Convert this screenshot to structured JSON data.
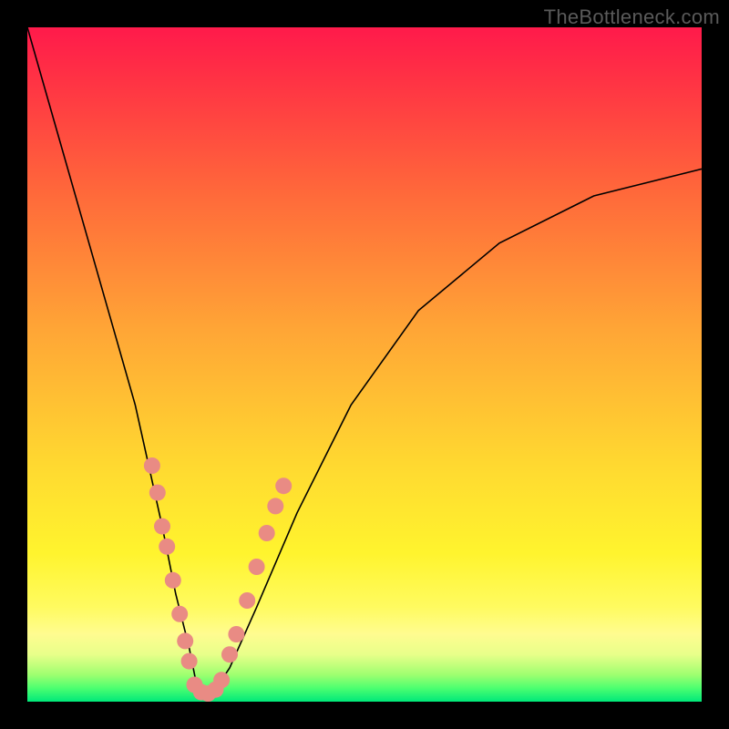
{
  "watermark": "TheBottleneck.com",
  "colors": {
    "background": "#000000",
    "curve": "#000000",
    "dot": "#e98b84",
    "gradient_top": "#ff1a4b",
    "gradient_bottom": "#00e87a"
  },
  "chart_data": {
    "type": "line",
    "title": "",
    "xlabel": "",
    "ylabel": "",
    "xlim": [
      0,
      100
    ],
    "ylim": [
      0,
      100
    ],
    "note": "Conceptual bottleneck V-curve; axes unlabeled; values estimated from pixel positions on a 0–100 normalized scale (y inverted to image space).",
    "series": [
      {
        "name": "curve",
        "x": [
          0,
          4,
          8,
          12,
          16,
          20,
          22,
          24,
          25,
          26,
          27,
          28,
          30,
          34,
          40,
          48,
          58,
          70,
          84,
          100
        ],
        "y": [
          100,
          86,
          72,
          58,
          44,
          26,
          16,
          8,
          3,
          1,
          1,
          2,
          5,
          14,
          28,
          44,
          58,
          68,
          75,
          79
        ]
      }
    ],
    "points_left_branch": [
      {
        "x": 18.5,
        "y": 35
      },
      {
        "x": 19.3,
        "y": 31
      },
      {
        "x": 20.0,
        "y": 26
      },
      {
        "x": 20.7,
        "y": 23
      },
      {
        "x": 21.6,
        "y": 18
      },
      {
        "x": 22.6,
        "y": 13
      },
      {
        "x": 23.4,
        "y": 9
      },
      {
        "x": 24.0,
        "y": 6
      }
    ],
    "points_right_branch": [
      {
        "x": 30.0,
        "y": 7
      },
      {
        "x": 31.0,
        "y": 10
      },
      {
        "x": 32.6,
        "y": 15
      },
      {
        "x": 34.0,
        "y": 20
      },
      {
        "x": 35.5,
        "y": 25
      },
      {
        "x": 36.8,
        "y": 29
      },
      {
        "x": 38.0,
        "y": 32
      }
    ],
    "points_bottom_cluster": [
      {
        "x": 24.8,
        "y": 2.5
      },
      {
        "x": 25.8,
        "y": 1.4
      },
      {
        "x": 26.8,
        "y": 1.2
      },
      {
        "x": 27.9,
        "y": 1.8
      },
      {
        "x": 28.8,
        "y": 3.2
      }
    ]
  }
}
